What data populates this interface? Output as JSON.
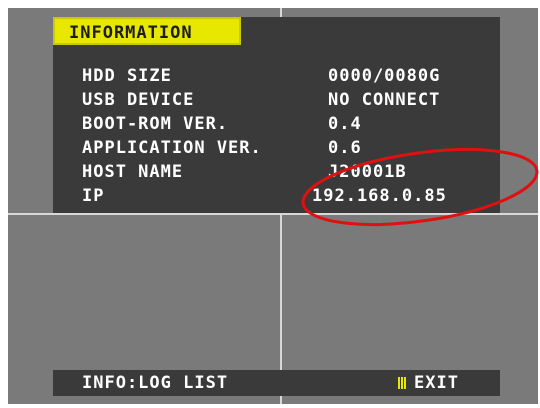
{
  "info_panel": {
    "title": "INFORMATION",
    "rows": [
      {
        "label": "HDD SIZE",
        "value": "0000/0080G"
      },
      {
        "label": "USB DEVICE",
        "value": "NO CONNECT"
      },
      {
        "label": "BOOT-ROM VER.",
        "value": "0.4"
      },
      {
        "label": "APPLICATION VER.",
        "value": "0.6"
      },
      {
        "label": "HOST NAME",
        "value": "J20001B"
      },
      {
        "label": "IP",
        "value": "192.168.0.85"
      }
    ]
  },
  "footer": {
    "left_label": "INFO:LOG LIST",
    "exit_label": "EXIT",
    "exit_icon": "menu-bars-icon"
  },
  "colors": {
    "screen_bg": "#7a7a7a",
    "panel_bg": "#3a3a3a",
    "title_bg": "#e7e700",
    "text": "#ffffff",
    "annotation_stroke": "#e01010"
  }
}
